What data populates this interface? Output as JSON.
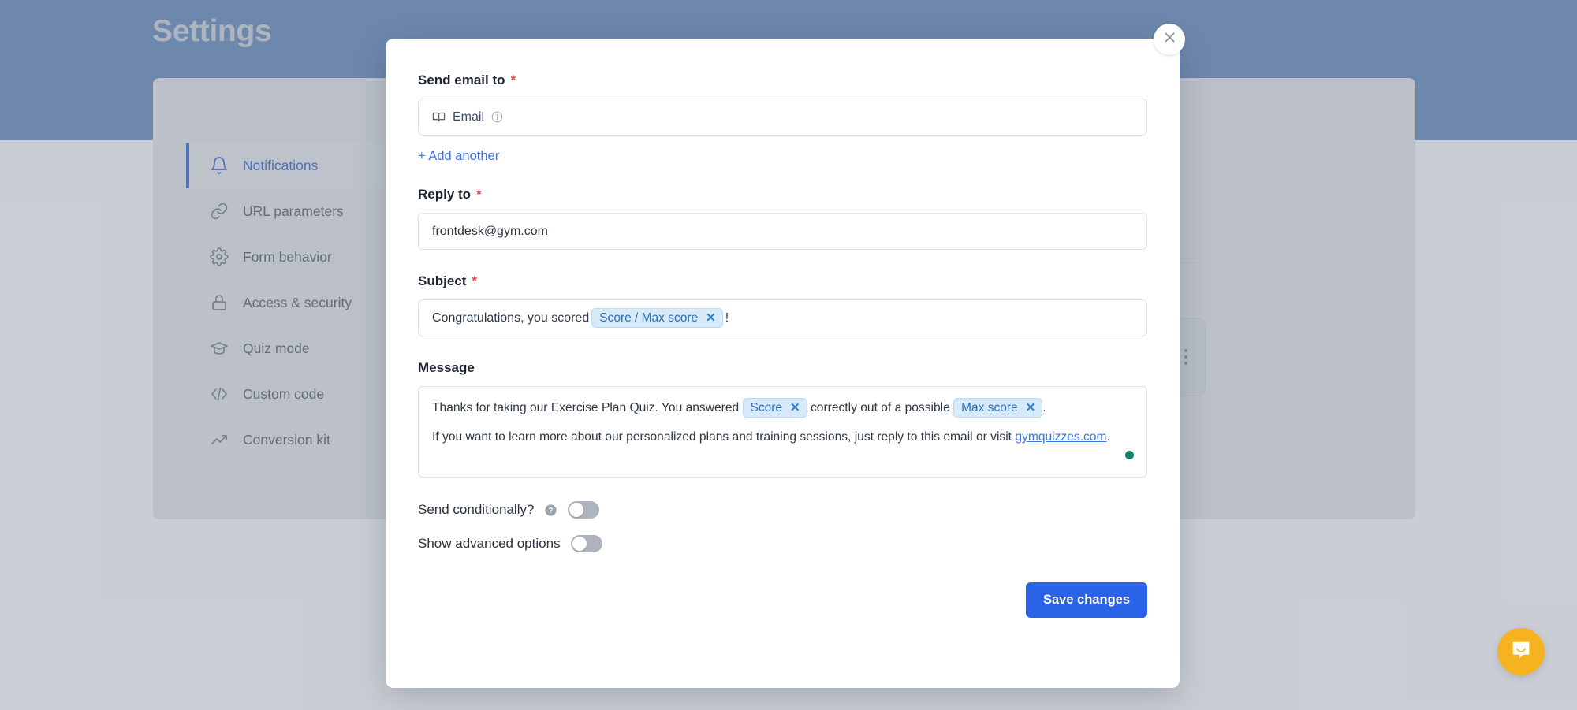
{
  "background": {
    "page_title": "Settings",
    "sidebar": {
      "items": [
        {
          "label": "Notifications",
          "icon": "bell-icon",
          "active": true
        },
        {
          "label": "URL parameters",
          "icon": "link-icon",
          "active": false
        },
        {
          "label": "Form behavior",
          "icon": "gear-icon",
          "active": false
        },
        {
          "label": "Access & security",
          "icon": "lock-icon",
          "active": false
        },
        {
          "label": "Quiz mode",
          "icon": "graduation-cap-icon",
          "active": false
        },
        {
          "label": "Custom code",
          "icon": "code-icon",
          "active": false
        },
        {
          "label": "Conversion kit",
          "icon": "trending-up-icon",
          "active": false
        }
      ]
    },
    "kebab_icon": "more-vertical-icon",
    "hero_color": "#6b8cba"
  },
  "modal": {
    "close_icon": "close-icon",
    "send_email_to": {
      "label": "Send email to",
      "required_marker": "*",
      "placeholder_token": "Email",
      "placeholder_icon": "book-icon",
      "info_icon": "info-icon",
      "add_another_label": "+ Add another"
    },
    "reply_to": {
      "label": "Reply to",
      "required_marker": "*",
      "value": "frontdesk@gym.com"
    },
    "subject": {
      "label": "Subject",
      "required_marker": "*",
      "text_before": "Congratulations, you scored",
      "token": "Score / Max score",
      "token_remove_icon": "close-icon",
      "text_after": "!"
    },
    "message": {
      "label": "Message",
      "line1_part1": "Thanks for taking our Exercise Plan Quiz. You answered",
      "line1_token1": "Score",
      "line1_part2": "correctly out of a possible",
      "line1_token2": "Max score",
      "line1_part3": ".",
      "line2_part1": "If you want to learn more about our personalized plans and training sessions, just reply to this email or visit",
      "line2_link": "gymquizzes.com",
      "line2_part2": ".",
      "status_dot_color": "#11806a"
    },
    "send_conditionally": {
      "label": "Send conditionally?",
      "help_icon": "help-circle-icon",
      "state": "off"
    },
    "show_advanced": {
      "label": "Show advanced options",
      "state": "off"
    },
    "save_label": "Save changes",
    "accent_color": "#2a63e8"
  },
  "chat_launcher": {
    "icon": "chat-bubble-icon",
    "color": "#f5b31f"
  }
}
